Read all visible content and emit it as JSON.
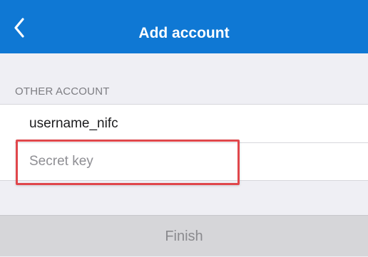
{
  "header": {
    "title": "Add account",
    "back_icon": "chevron-left-icon",
    "background_color": "#0f78d4"
  },
  "section": {
    "label": "OTHER ACCOUNT"
  },
  "form": {
    "username": {
      "value": "username_nifc"
    },
    "secret_key": {
      "value": "",
      "placeholder": "Secret key"
    }
  },
  "highlight": {
    "color": "#e0474c"
  },
  "footer": {
    "finish_label": "Finish",
    "state": "disabled"
  }
}
